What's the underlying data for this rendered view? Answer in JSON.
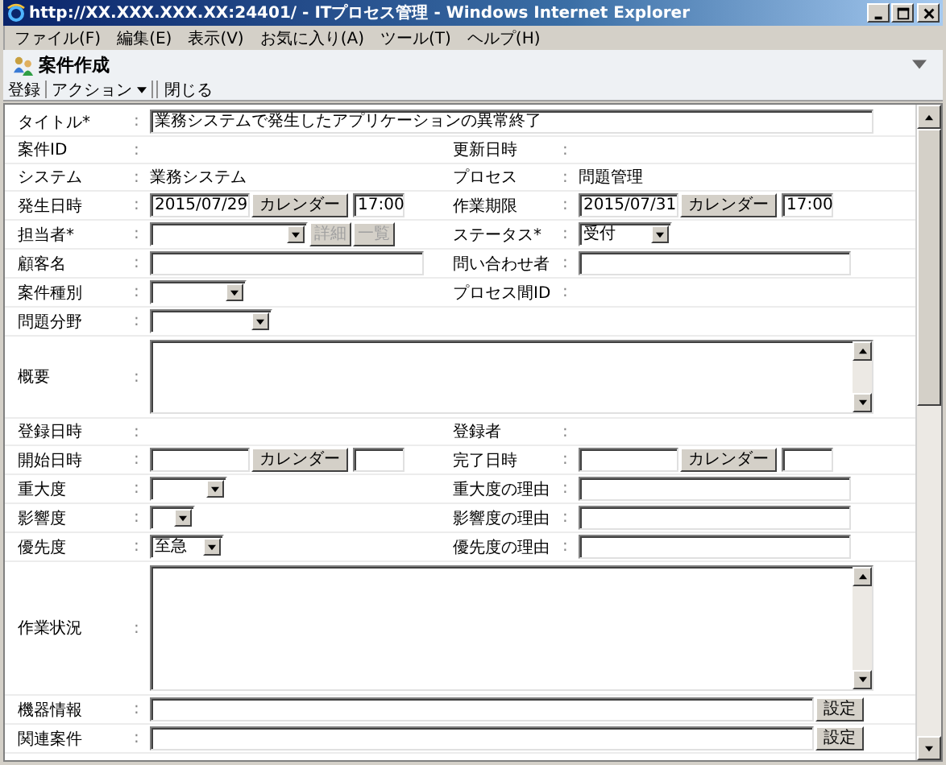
{
  "window": {
    "title": "http://XX.XXX.XXX.XX:24401/ - ITプロセス管理 - Windows Internet Explorer"
  },
  "menu": [
    "ファイル(F)",
    "編集(E)",
    "表示(V)",
    "お気に入り(A)",
    "ツール(T)",
    "ヘルプ(H)"
  ],
  "page": {
    "title": "案件作成",
    "toolbar": [
      {
        "label": "登録",
        "kind": "button"
      },
      {
        "label": "アクション",
        "kind": "menu"
      },
      {
        "label": "閉じる",
        "kind": "button"
      }
    ]
  },
  "form": {
    "rows": [
      {
        "kind": "wide",
        "label": "タイトル*",
        "colon": ":",
        "control": {
          "kind": "input",
          "value": "業務システムで発生したアプリケーションの異常終了"
        }
      },
      {
        "kind": "pair",
        "cells": [
          {
            "label": "案件ID",
            "colon": ":"
          },
          {
            "label": "更新日時",
            "colon": ":"
          }
        ]
      },
      {
        "kind": "pair",
        "cells": [
          {
            "label": "システム",
            "colon": ":",
            "control": {
              "kind": "text",
              "value": "業務システム"
            }
          },
          {
            "label": "プロセス",
            "colon": ":",
            "control": {
              "kind": "text",
              "value": "問題管理"
            }
          }
        ]
      },
      {
        "kind": "pair",
        "cells": [
          {
            "label": "発生日時",
            "colon": ":",
            "control": {
              "kind": "date",
              "value": "2015/07/29",
              "button": "カレンダー",
              "time": "17:00"
            }
          },
          {
            "label": "作業期限",
            "colon": ":",
            "control": {
              "kind": "date",
              "value": "2015/07/31",
              "button": "カレンダー",
              "time": "17:00"
            }
          }
        ]
      },
      {
        "kind": "pair",
        "cells": [
          {
            "label": "担当者*",
            "colon": ":",
            "control": {
              "kind": "select",
              "buttons": [
                {
                  "label": "詳細",
                  "disabled": true
                },
                {
                  "label": "一覧",
                  "disabled": true
                }
              ]
            }
          },
          {
            "label": "ステータス*",
            "colon": ":",
            "control": {
              "kind": "select",
              "value": "受付"
            }
          }
        ]
      },
      {
        "kind": "pair",
        "cells": [
          {
            "label": "顧客名",
            "colon": ":",
            "control": {
              "kind": "input"
            }
          },
          {
            "label": "問い合わせ者",
            "colon": ":",
            "control": {
              "kind": "input"
            }
          }
        ]
      },
      {
        "kind": "pair",
        "cells": [
          {
            "label": "案件種別",
            "colon": ":",
            "control": {
              "kind": "select"
            }
          },
          {
            "label": "プロセス間ID",
            "colon": ":"
          }
        ]
      },
      {
        "kind": "pair",
        "cells": [
          {
            "label": "問題分野",
            "colon": ":",
            "control": {
              "kind": "select"
            }
          }
        ]
      },
      {
        "kind": "wide",
        "label": "概要",
        "colon": ":",
        "control": {
          "kind": "textarea"
        }
      },
      {
        "kind": "pair",
        "cells": [
          {
            "label": "登録日時",
            "colon": ":"
          },
          {
            "label": "登録者",
            "colon": ":"
          }
        ]
      },
      {
        "kind": "pair",
        "cells": [
          {
            "label": "開始日時",
            "colon": ":",
            "control": {
              "kind": "date",
              "button": "カレンダー"
            }
          },
          {
            "label": "完了日時",
            "colon": ":",
            "control": {
              "kind": "date",
              "button": "カレンダー"
            }
          }
        ]
      },
      {
        "kind": "pair",
        "cells": [
          {
            "label": "重大度",
            "colon": ":",
            "control": {
              "kind": "select"
            }
          },
          {
            "label": "重大度の理由",
            "colon": ":",
            "control": {
              "kind": "input"
            }
          }
        ]
      },
      {
        "kind": "pair",
        "cells": [
          {
            "label": "影響度",
            "colon": ":",
            "control": {
              "kind": "select"
            }
          },
          {
            "label": "影響度の理由",
            "colon": ":",
            "control": {
              "kind": "input"
            }
          }
        ]
      },
      {
        "kind": "pair",
        "cells": [
          {
            "label": "優先度",
            "colon": ":",
            "control": {
              "kind": "select",
              "value": "至急"
            }
          },
          {
            "label": "優先度の理由",
            "colon": ":",
            "control": {
              "kind": "input"
            }
          }
        ]
      },
      {
        "kind": "wide",
        "label": "作業状況",
        "colon": ":",
        "control": {
          "kind": "textarea"
        }
      },
      {
        "kind": "wide",
        "label": "機器情報",
        "colon": ":",
        "control": {
          "kind": "input",
          "button": "設定"
        }
      },
      {
        "kind": "wide",
        "label": "関連案件",
        "colon": ":",
        "control": {
          "kind": "input",
          "button": "設定"
        }
      }
    ]
  }
}
